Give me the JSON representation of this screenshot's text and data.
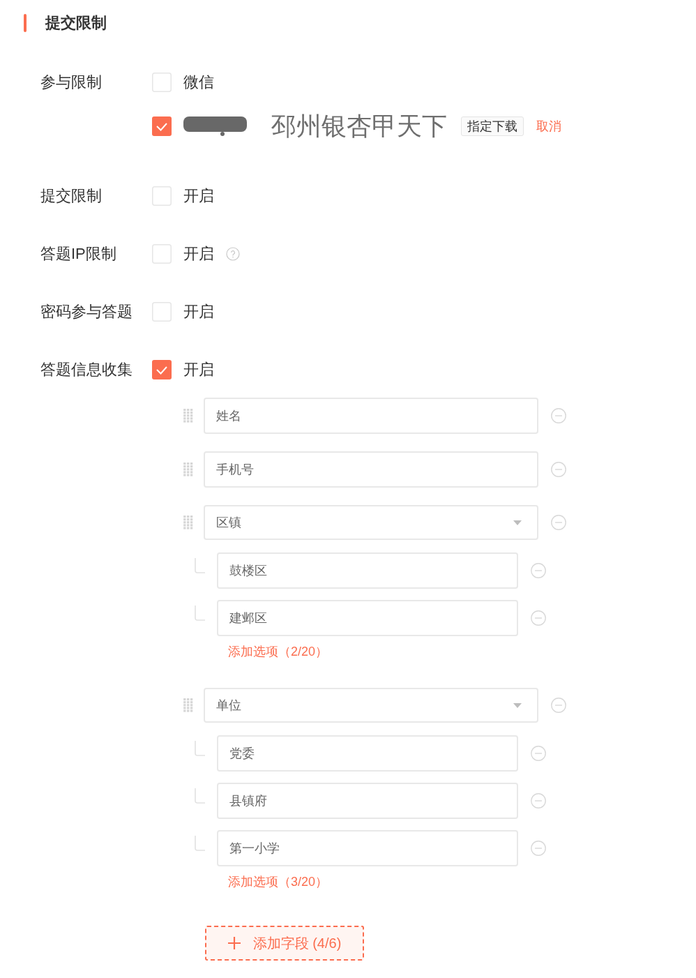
{
  "section": {
    "title": "提交限制"
  },
  "settings": [
    {
      "label": "参与限制",
      "options": [
        {
          "kind": "text",
          "text": "微信",
          "checked": false,
          "help": false
        },
        {
          "kind": "redacted",
          "checked": true,
          "caption": "邳州银杏甲天下",
          "button": "指定下载",
          "link": "取消"
        }
      ]
    },
    {
      "label": "提交限制",
      "options": [
        {
          "kind": "text",
          "text": "开启",
          "checked": false,
          "help": false
        }
      ]
    },
    {
      "label": "答题IP限制",
      "options": [
        {
          "kind": "text",
          "text": "开启",
          "checked": false,
          "help": true
        }
      ]
    },
    {
      "label": "密码参与答题",
      "options": [
        {
          "kind": "text",
          "text": "开启",
          "checked": false,
          "help": false
        }
      ]
    },
    {
      "label": "答题信息收集",
      "options": [
        {
          "kind": "text",
          "text": "开启",
          "checked": true,
          "help": false
        }
      ]
    }
  ],
  "info_fields": [
    {
      "kind": "input",
      "value": "姓名"
    },
    {
      "kind": "input",
      "value": "手机号"
    },
    {
      "kind": "select",
      "value": "区镇",
      "options": [
        "鼓楼区",
        "建邺区"
      ],
      "add_option": "添加选项（2/20）"
    },
    {
      "kind": "select",
      "value": "单位",
      "options": [
        "党委",
        "县镇府",
        "第一小学"
      ],
      "add_option": "添加选项（3/20）"
    }
  ],
  "add_field_button": "添加字段 (4/6)"
}
